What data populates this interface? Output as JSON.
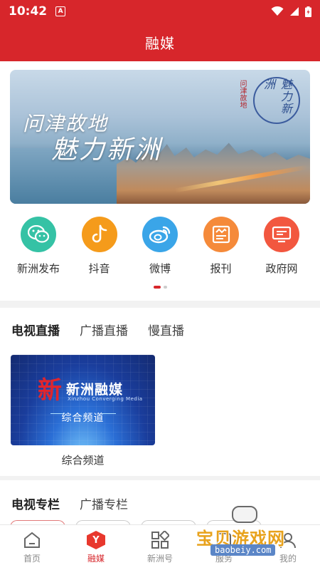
{
  "status_bar": {
    "time": "10:42",
    "notification_icon": "A"
  },
  "app_bar": {
    "title": "融媒"
  },
  "banner": {
    "slogan_line1": "问津故地",
    "slogan_line2": "魅力新洲",
    "seal_text": "魅力新洲",
    "vertical_text": "问津故地"
  },
  "quick_links": [
    {
      "label": "新洲发布",
      "icon": "wechat-icon",
      "color": "#35c2a5"
    },
    {
      "label": "抖音",
      "icon": "douyin-icon",
      "color": "#f59b1b"
    },
    {
      "label": "微博",
      "icon": "weibo-icon",
      "color": "#3aa5e8"
    },
    {
      "label": "报刊",
      "icon": "newspaper-icon",
      "color": "#f58a3a"
    },
    {
      "label": "政府网",
      "icon": "monitor-icon",
      "color": "#f2573f"
    }
  ],
  "live_section": {
    "tabs": [
      "电视直播",
      "广播直播",
      "慢直播"
    ],
    "active_tab": 0,
    "channel": {
      "brand": "新洲融媒",
      "brand_en": "Xinzhou Converging Media",
      "logo_char": "新",
      "name": "综合频道",
      "caption": "综合频道"
    }
  },
  "column_section": {
    "tabs": [
      "电视专栏",
      "广播专栏"
    ],
    "active_tab": 0
  },
  "bottom_nav": [
    {
      "label": "首页",
      "icon": "home-icon",
      "active": false
    },
    {
      "label": "融媒",
      "icon": "rongmei-icon",
      "active": true,
      "badge_char": "Y"
    },
    {
      "label": "新洲号",
      "icon": "grid-icon",
      "active": false
    },
    {
      "label": "服务",
      "icon": "service-icon",
      "active": false
    },
    {
      "label": "我的",
      "icon": "profile-icon",
      "active": false
    }
  ],
  "watermark": {
    "text": "宝贝游戏网",
    "url": "baobeiy.com"
  },
  "colors": {
    "brand_red": "#d7262b",
    "text": "#333333",
    "muted": "#8a8a8a"
  }
}
